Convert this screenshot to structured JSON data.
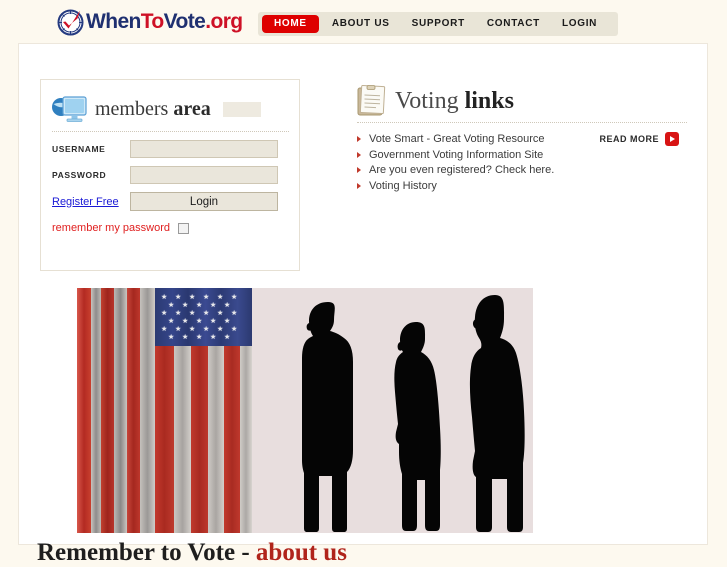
{
  "site": {
    "logo": {
      "icon": "clock-check-icon",
      "part1": "When",
      "part2": "To",
      "part3": "Vote",
      "part4": ".org"
    }
  },
  "nav": {
    "items": [
      {
        "label": "HOME",
        "active": true
      },
      {
        "label": "ABOUT US",
        "active": false
      },
      {
        "label": "SUPPORT",
        "active": false
      },
      {
        "label": "CONTACT",
        "active": false
      },
      {
        "label": "LOGIN",
        "active": false
      }
    ]
  },
  "members_area": {
    "title_light": "members ",
    "title_bold": "area",
    "icon": "computer-monitor-icon",
    "username_label": "USERNAME",
    "username_value": "",
    "username_placeholder": "",
    "password_label": "PASSWORD",
    "password_value": "",
    "password_placeholder": "",
    "register_link": "Register Free",
    "login_button": "Login",
    "remember_label": "remember my password",
    "remember_checked": false
  },
  "voting_links": {
    "icon": "clipboard-icon",
    "title_light": "Voting ",
    "title_bold": "links",
    "items": [
      "Vote Smart - Great Voting Resource",
      "Government Voting Information Site",
      "Are you even registered? Check here.",
      "Voting History"
    ],
    "read_more_label": "READ MORE",
    "read_more_icon": "play-arrow-icon"
  },
  "hero": {
    "alt": "american-flag-and-voter-silhouettes"
  },
  "headline": {
    "main": "Remember to Vote - ",
    "accent": "about us"
  },
  "colors": {
    "page_background": "#FDF9EF",
    "content_background": "#FFFFFF",
    "nav_background": "#E9E5D7",
    "accent_red": "#DE0000",
    "logo_navy": "#1F3070",
    "logo_red": "#CE1126",
    "link_blue": "#1A19D6",
    "input_background": "#EAE6DB"
  }
}
